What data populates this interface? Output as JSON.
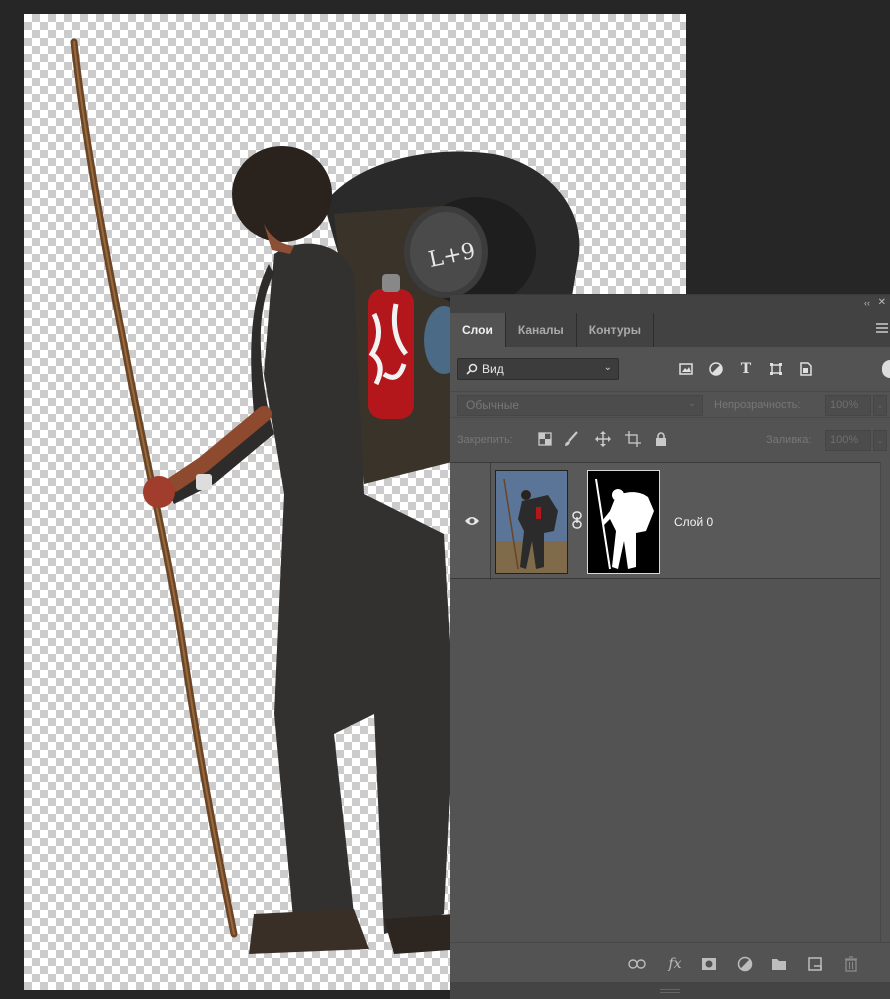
{
  "panel": {
    "collapse_glyph": "‹‹",
    "close_glyph": "✕",
    "tabs": [
      {
        "label": "Слои"
      },
      {
        "label": "Каналы"
      },
      {
        "label": "Контуры"
      }
    ],
    "filter": {
      "selected": "Вид",
      "icons": [
        "image-filter-icon",
        "adjustment-filter-icon",
        "type-filter-icon",
        "shape-filter-icon",
        "smart-object-filter-icon"
      ]
    },
    "blend_mode": "Обычные",
    "opacity_label": "Непрозрачность:",
    "opacity_value": "100%",
    "lock_label": "Закрепить:",
    "lock_icons": [
      "lock-transparent-pixels-icon",
      "lock-image-pixels-icon",
      "lock-position-icon",
      "lock-artboard-icon",
      "lock-all-icon"
    ],
    "fill_label": "Заливка:",
    "fill_value": "100%",
    "layers": [
      {
        "name": "Слой 0",
        "visible": true
      }
    ],
    "bottom_icons": [
      "link-layers-icon",
      "fx-icon",
      "add-mask-icon",
      "new-adjustment-layer-icon",
      "new-group-icon",
      "new-layer-icon",
      "delete-layer-icon"
    ]
  },
  "canvas": {
    "bottle_text": "L+9"
  }
}
